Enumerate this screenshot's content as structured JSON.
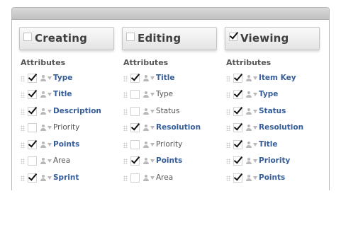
{
  "columns": [
    {
      "title": "Creating",
      "header_checked": false,
      "attributes_heading": "Attributes",
      "rows": [
        {
          "label": "Type",
          "checked": true
        },
        {
          "label": "Title",
          "checked": true
        },
        {
          "label": "Description",
          "checked": true
        },
        {
          "label": "Priority",
          "checked": false
        },
        {
          "label": "Points",
          "checked": true
        },
        {
          "label": "Area",
          "checked": false
        },
        {
          "label": "Sprint",
          "checked": true
        }
      ]
    },
    {
      "title": "Editing",
      "header_checked": false,
      "attributes_heading": "Attributes",
      "rows": [
        {
          "label": "Title",
          "checked": true
        },
        {
          "label": "Type",
          "checked": false
        },
        {
          "label": "Status",
          "checked": false
        },
        {
          "label": "Resolution",
          "checked": true
        },
        {
          "label": "Priority",
          "checked": false
        },
        {
          "label": "Points",
          "checked": true
        },
        {
          "label": "Area",
          "checked": false
        }
      ]
    },
    {
      "title": "Viewing",
      "header_checked": true,
      "attributes_heading": "Attributes",
      "rows": [
        {
          "label": "Item Key",
          "checked": true
        },
        {
          "label": "Type",
          "checked": true
        },
        {
          "label": "Status",
          "checked": true
        },
        {
          "label": "Resolution",
          "checked": true
        },
        {
          "label": "Title",
          "checked": true
        },
        {
          "label": "Priority",
          "checked": true
        },
        {
          "label": "Points",
          "checked": true
        }
      ]
    }
  ],
  "colors": {
    "checked_label": "#345d99",
    "unchecked_label": "#555555"
  }
}
